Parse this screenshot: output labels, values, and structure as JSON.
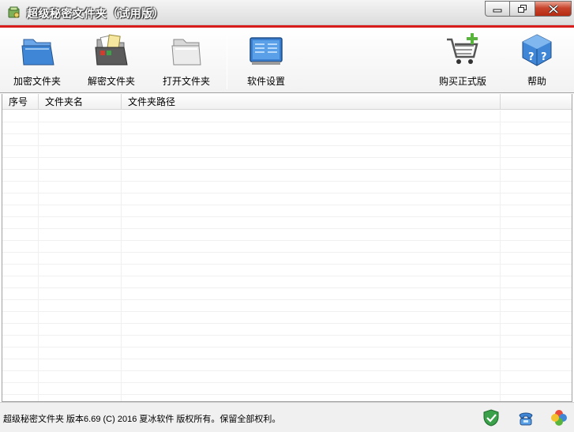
{
  "window": {
    "title": "超级秘密文件夹（试用版）",
    "controls": [
      "minimize",
      "restore",
      "close"
    ]
  },
  "toolbar": {
    "encrypt": {
      "label": "加密文件夹",
      "icon": "blue-folder-icon"
    },
    "decrypt": {
      "label": "解密文件夹",
      "icon": "open-folder-icon"
    },
    "open": {
      "label": "打开文件夹",
      "icon": "grey-folder-icon"
    },
    "settings": {
      "label": "软件设置",
      "icon": "settings-panel-icon"
    },
    "buy": {
      "label": "购买正式版",
      "icon": "shopping-cart-icon"
    },
    "help": {
      "label": "帮助",
      "icon": "help-cube-icon"
    }
  },
  "table": {
    "columns": [
      "序号",
      "文件夹名",
      "文件夹路径"
    ],
    "rows": []
  },
  "status": {
    "text": "超级秘密文件夹 版本6.69 (C) 2016 夏冰软件 版权所有。保留全部权利。",
    "icons": [
      "shield-check-icon",
      "phone-icon",
      "colorful-clover-icon"
    ]
  },
  "colors": {
    "accent_red": "#d81c1c",
    "close_button": "#c8452d",
    "icon_blue": "#3f86d6"
  }
}
